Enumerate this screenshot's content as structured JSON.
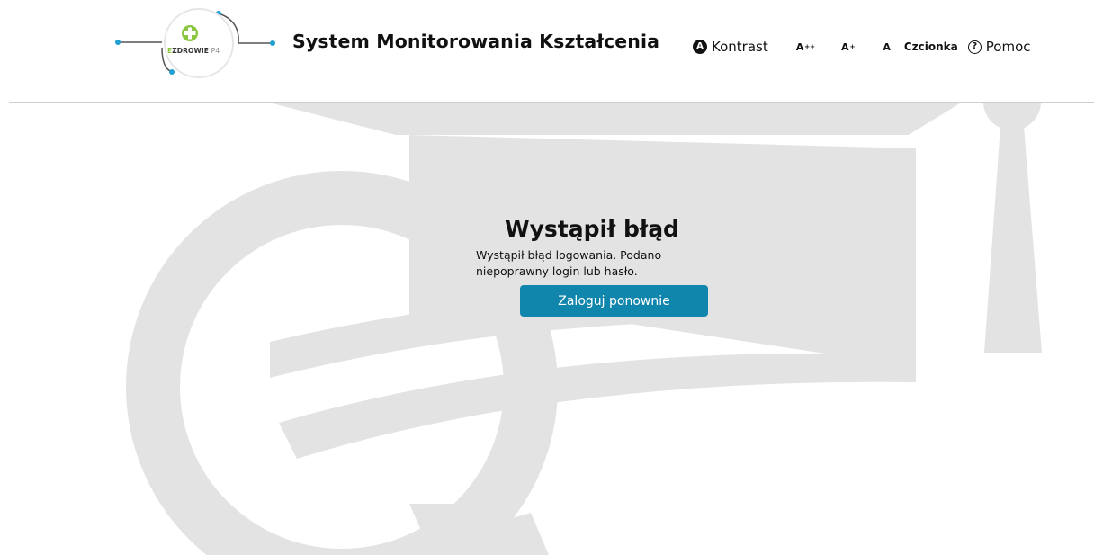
{
  "header": {
    "logo": {
      "text_prefix": "E",
      "text_main": "ZDROWIE",
      "text_suffix": "P4"
    },
    "title": "System Monitorowania Kształcenia",
    "toolbar": {
      "contrast_label": "Kontrast",
      "font_large": "A",
      "font_large_sup": "++",
      "font_medium": "A",
      "font_medium_sup": "+",
      "font_normal": "A",
      "font_label": "Czcionka",
      "help_label": "Pomoc"
    }
  },
  "error": {
    "title": "Wystąpił błąd",
    "message": "Wystąpił błąd logowania. Podano niepoprawny login lub hasło.",
    "button_label": "Zaloguj ponownie"
  },
  "colors": {
    "accent": "#1186ad",
    "watermark": "#e3e3e3",
    "logo_green": "#8ac640",
    "logo_blue": "#1fa0d0"
  }
}
